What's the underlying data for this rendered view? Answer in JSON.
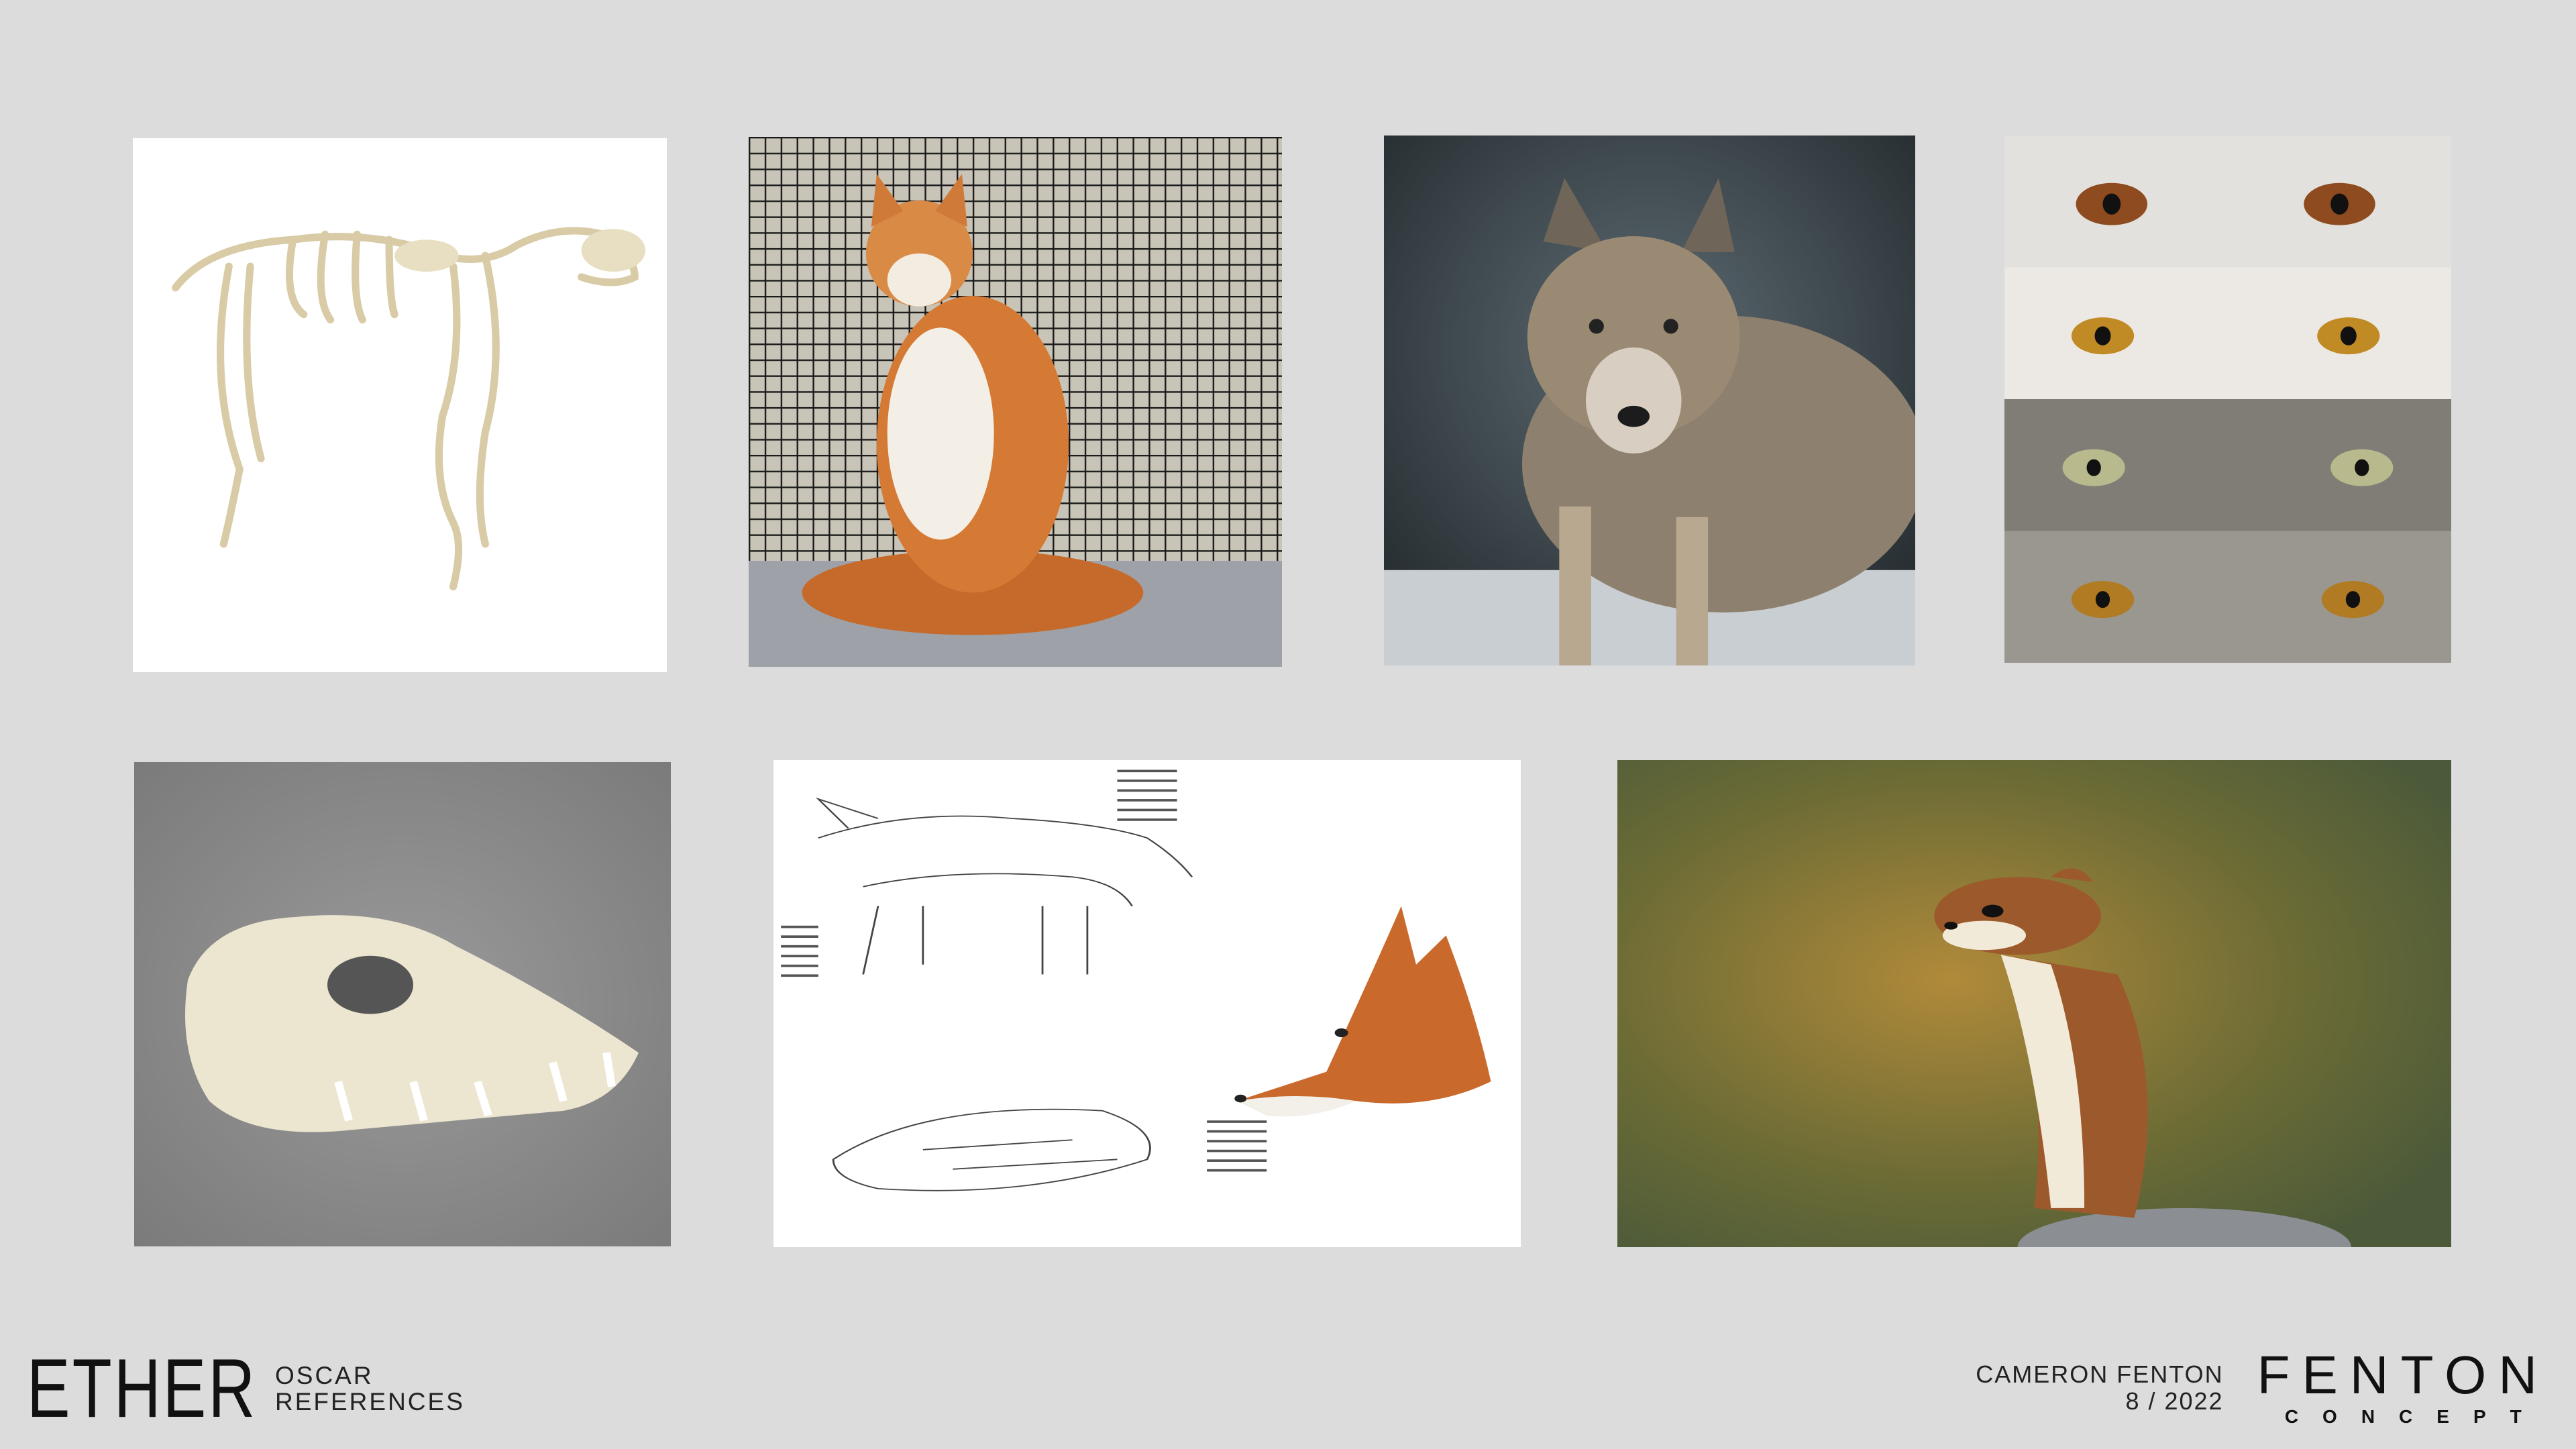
{
  "footer": {
    "logo": "ETHER",
    "line1": "OSCAR",
    "line2": "REFERENCES",
    "author": "CAMERON FENTON",
    "date": "8 / 2022",
    "brand_name": "FENTON",
    "brand_sub": "CONCEPT"
  },
  "colors": {
    "background": "#dcdcdc",
    "text": "#222222"
  },
  "gallery": {
    "images": [
      {
        "subject": "canine-skeleton"
      },
      {
        "subject": "long-haired-orange-white-cat"
      },
      {
        "subject": "grey-wolf"
      },
      {
        "subject": "wolf-eyes-closeups"
      },
      {
        "subject": "canine-skull"
      },
      {
        "subject": "fox-anatomy-study-sketch"
      },
      {
        "subject": "stoat"
      }
    ]
  }
}
